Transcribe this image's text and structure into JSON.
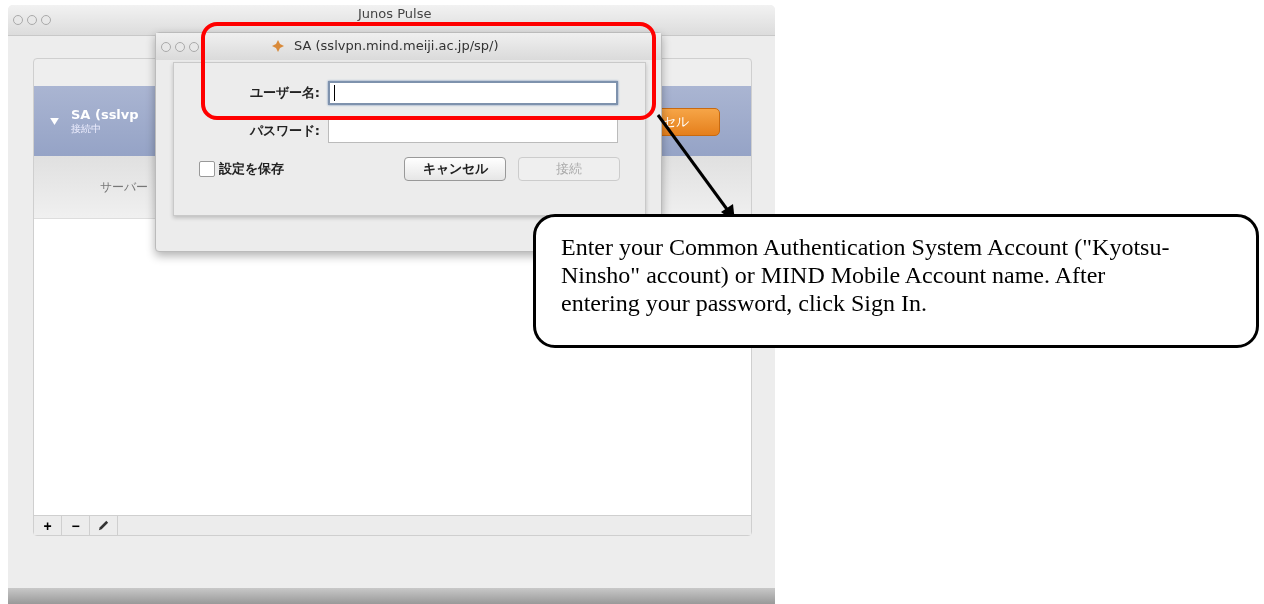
{
  "main_window": {
    "title": "Junos Pulse",
    "connection": {
      "name": "SA (sslvp",
      "status": "接続中",
      "expanded": true,
      "button": "セル"
    },
    "server_label": "サーバー",
    "toolbar": [
      {
        "kind": "text",
        "label": "+"
      },
      {
        "kind": "text",
        "label": "−"
      },
      {
        "kind": "pencil"
      }
    ]
  },
  "dialog": {
    "title": "SA (sslvpn.mind.meiji.ac.jp/sp/)",
    "fields": [
      {
        "label": "ユーザー名:",
        "focused": true
      },
      {
        "label": "パスワード:",
        "focused": false
      }
    ],
    "checkbox": {
      "label": "設定を保存",
      "checked": false
    },
    "buttons": [
      {
        "label": "キャンセル",
        "disabled": false
      },
      {
        "label": "接続",
        "disabled": true
      }
    ]
  },
  "annotation": {
    "text": "Enter your Common Authentication System Account (\"Kyotsu-Ninsho\" account) or MIND Mobile Account name. After entering your password, click Sign In."
  }
}
